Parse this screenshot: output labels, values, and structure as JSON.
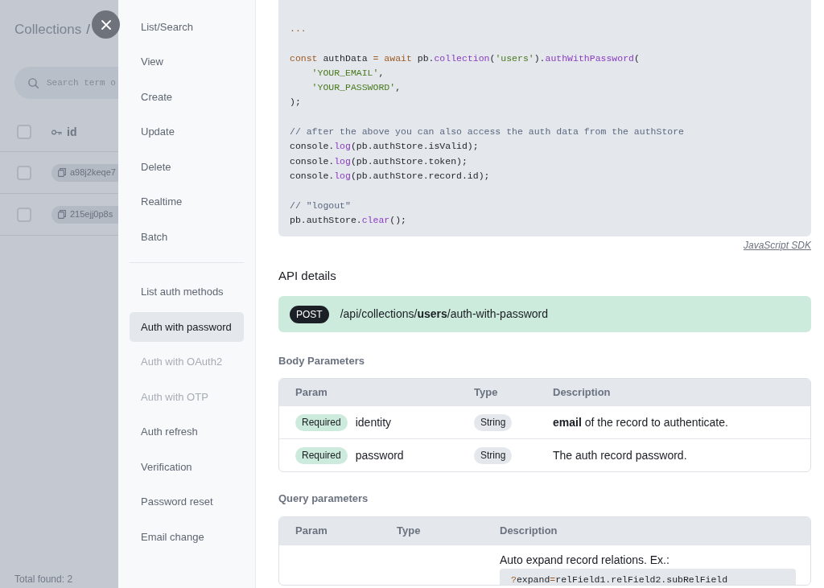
{
  "background_page": {
    "breadcrumb": {
      "link": "Collections",
      "separator": "/"
    },
    "search": {
      "placeholder": "Search term o"
    },
    "table": {
      "header": {
        "checked": false,
        "column": "id"
      },
      "rows": [
        {
          "checked": false,
          "id": "a98j2keqe7"
        },
        {
          "checked": false,
          "id": "215ejj0p8s"
        }
      ]
    },
    "total": "Total found: 2"
  },
  "sidebar": {
    "sections": [
      {
        "items": [
          {
            "label": "List/Search",
            "selected": false,
            "disabled": false
          },
          {
            "label": "View",
            "selected": false,
            "disabled": false
          },
          {
            "label": "Create",
            "selected": false,
            "disabled": false
          },
          {
            "label": "Update",
            "selected": false,
            "disabled": false
          },
          {
            "label": "Delete",
            "selected": false,
            "disabled": false
          },
          {
            "label": "Realtime",
            "selected": false,
            "disabled": false
          },
          {
            "label": "Batch",
            "selected": false,
            "disabled": false
          }
        ]
      },
      {
        "items": [
          {
            "label": "List auth methods",
            "selected": false,
            "disabled": false
          },
          {
            "label": "Auth with password",
            "selected": true,
            "disabled": false
          },
          {
            "label": "Auth with OAuth2",
            "selected": false,
            "disabled": true
          },
          {
            "label": "Auth with OTP",
            "selected": false,
            "disabled": true
          },
          {
            "label": "Auth refresh",
            "selected": false,
            "disabled": false
          },
          {
            "label": "Verification",
            "selected": false,
            "disabled": false
          },
          {
            "label": "Password reset",
            "selected": false,
            "disabled": false
          },
          {
            "label": "Email change",
            "selected": false,
            "disabled": false
          }
        ]
      }
    ]
  },
  "code": {
    "blocks": [
      {
        "lines": [
          [
            {
              "kind": "operator",
              "text": "..."
            }
          ]
        ]
      },
      {
        "lines": [
          [
            {
              "kind": "keyword",
              "text": "const"
            },
            {
              "kind": "plain",
              "text": " authData "
            },
            {
              "kind": "operator",
              "text": "= "
            },
            {
              "kind": "keyword",
              "text": "await"
            },
            {
              "kind": "plain",
              "text": " pb."
            },
            {
              "kind": "function",
              "text": "collection"
            },
            {
              "kind": "plain",
              "text": "("
            },
            {
              "kind": "string",
              "text": "'users'"
            },
            {
              "kind": "plain",
              "text": ")."
            },
            {
              "kind": "function",
              "text": "authWithPassword"
            },
            {
              "kind": "plain",
              "text": "("
            }
          ],
          [
            {
              "kind": "string",
              "text": "    'YOUR_EMAIL'"
            },
            {
              "kind": "plain",
              "text": ","
            }
          ],
          [
            {
              "kind": "string",
              "text": "    'YOUR_PASSWORD'"
            },
            {
              "kind": "plain",
              "text": ","
            }
          ],
          [
            {
              "kind": "plain",
              "text": ");"
            }
          ]
        ]
      },
      {
        "lines": [
          [
            {
              "kind": "comment",
              "text": "// after the above you can also access the auth data from the authStore"
            }
          ],
          [
            {
              "kind": "plain",
              "text": "console."
            },
            {
              "kind": "function",
              "text": "log"
            },
            {
              "kind": "plain",
              "text": "(pb.authStore.isValid);"
            }
          ],
          [
            {
              "kind": "plain",
              "text": "console."
            },
            {
              "kind": "function",
              "text": "log"
            },
            {
              "kind": "plain",
              "text": "(pb.authStore.token);"
            }
          ],
          [
            {
              "kind": "plain",
              "text": "console."
            },
            {
              "kind": "function",
              "text": "log"
            },
            {
              "kind": "plain",
              "text": "(pb.authStore.record.id);"
            }
          ]
        ]
      },
      {
        "lines": [
          [
            {
              "kind": "comment",
              "text": "// \"logout\""
            }
          ],
          [
            {
              "kind": "plain",
              "text": "pb.authStore."
            },
            {
              "kind": "function",
              "text": "clear"
            },
            {
              "kind": "plain",
              "text": "();"
            }
          ]
        ]
      }
    ],
    "sdk_label": "JavaScript SDK"
  },
  "api_details": {
    "title": "API details",
    "method": "POST",
    "path": "/api/collections/**users**/auth-with-password"
  },
  "body_parameters": {
    "title": "Body Parameters",
    "columns": [
      "Param",
      "Type",
      "Description"
    ],
    "rows": [
      {
        "badge": "Required",
        "name": "identity",
        "type": "String",
        "description": "**email** of the record to authenticate."
      },
      {
        "badge": "Required",
        "name": "password",
        "type": "String",
        "description": "The auth record password."
      }
    ]
  },
  "query_parameters": {
    "title": "Query parameters",
    "columns": [
      "Param",
      "Type",
      "Description"
    ],
    "rows": [
      {
        "description": "Auto expand record relations. Ex.:",
        "example": [
          {
            "kind": "operator",
            "text": "?"
          },
          {
            "kind": "plain",
            "text": "expand"
          },
          {
            "kind": "operator",
            "text": "="
          },
          {
            "kind": "plain",
            "text": "relField1.relField2.subRelField"
          }
        ]
      }
    ]
  }
}
